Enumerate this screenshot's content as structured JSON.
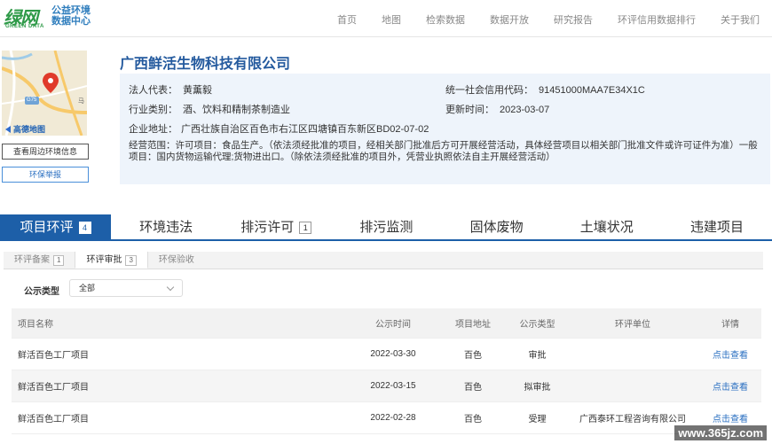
{
  "header": {
    "logo_big": "绿网",
    "logo_small": "GREEN DATA",
    "logo_line1": "公益环境",
    "logo_line2": "数据中心",
    "nav": [
      "首页",
      "地图",
      "检索数据",
      "数据开放",
      "研究报告",
      "环评信用数据排行",
      "关于我们"
    ]
  },
  "map": {
    "provider": "高德地图",
    "road_label": "G75",
    "road_label2": "马"
  },
  "actions": {
    "env_info_button": "查看周边环境信息",
    "report_button": "环保举报"
  },
  "company": {
    "name": "广西鲜活生物科技有限公司",
    "legal_rep_label": "法人代表：",
    "legal_rep": "黄薰毅",
    "credit_code_label": "统一社会信用代码：",
    "credit_code": "91451000MAA7E34X1C",
    "industry_label": "行业类别：",
    "industry": "酒、饮料和精制茶制造业",
    "updated_label": "更新时间：",
    "updated": "2023-03-07",
    "address_label": "企业地址：",
    "address": "广西壮族自治区百色市右江区四塘镇百东新区BD02-07-02",
    "scope_label": "经营范围：",
    "scope": "许可项目：食品生产。（依法须经批准的项目，经相关部门批准后方可开展经营活动，具体经营项目以相关部门批准文件或许可证件为准）一般项目：国内货物运输代理;货物进出口。（除依法须经批准的项目外，凭营业执照依法自主开展经营活动）"
  },
  "tabs": [
    {
      "label": "项目环评",
      "badge": "4"
    },
    {
      "label": "环境违法",
      "badge": ""
    },
    {
      "label": "排污许可",
      "badge": "1"
    },
    {
      "label": "排污监测",
      "badge": ""
    },
    {
      "label": "固体废物",
      "badge": ""
    },
    {
      "label": "土壤状况",
      "badge": ""
    },
    {
      "label": "违建项目",
      "badge": ""
    }
  ],
  "subtabs": [
    {
      "label": "环评备案",
      "badge": "1"
    },
    {
      "label": "环评审批",
      "badge": "3"
    },
    {
      "label": "环保验收",
      "badge": ""
    }
  ],
  "filter": {
    "label": "公示类型",
    "value": "全部"
  },
  "table": {
    "headers": [
      "项目名称",
      "公示时间",
      "项目地址",
      "公示类型",
      "环评单位",
      "详情"
    ],
    "rows": [
      {
        "name": "鲜活百色工厂项目",
        "date": "2022-03-30",
        "location": "百色",
        "type": "审批",
        "unit": "",
        "detail": "点击查看"
      },
      {
        "name": "鲜活百色工厂项目",
        "date": "2022-03-15",
        "location": "百色",
        "type": "拟审批",
        "unit": "",
        "detail": "点击查看"
      },
      {
        "name": "鲜活百色工厂项目",
        "date": "2022-02-28",
        "location": "百色",
        "type": "受理",
        "unit": "广西泰环工程咨询有限公司",
        "detail": "点击查看"
      }
    ]
  },
  "watermark": "www.365jz.com",
  "colors": {
    "brand_green": "#2e9a48",
    "primary_blue": "#1d5fa8",
    "link_blue": "#2a6fc1",
    "info_bg": "#eef4fb"
  }
}
